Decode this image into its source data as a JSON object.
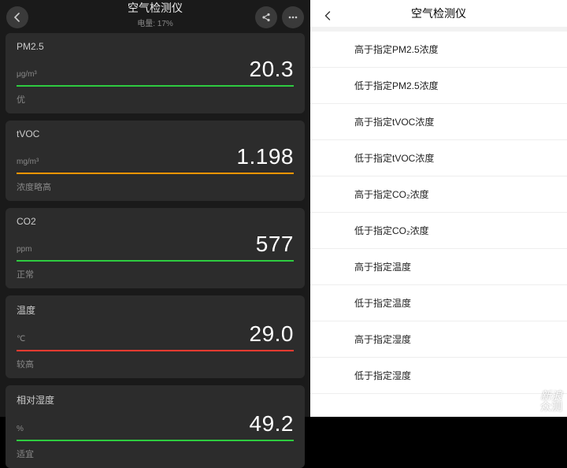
{
  "left": {
    "title": "空气检测仪",
    "subtitle": "电量: 17%",
    "cards": [
      {
        "name": "PM2.5",
        "unit": "μg/m³",
        "value": "20.3",
        "status": "优",
        "barColor": "green"
      },
      {
        "name": "tVOC",
        "unit": "mg/m³",
        "value": "1.198",
        "status": "浓度略高",
        "barColor": "orange"
      },
      {
        "name": "CO2",
        "unit": "ppm",
        "value": "577",
        "status": "正常",
        "barColor": "green"
      },
      {
        "name": "温度",
        "unit": "℃",
        "value": "29.0",
        "status": "较高",
        "barColor": "red"
      },
      {
        "name": "相对湿度",
        "unit": "%",
        "value": "49.2",
        "status": "适宜",
        "barColor": "green"
      }
    ]
  },
  "right": {
    "title": "空气检测仪",
    "items": [
      "高于指定PM2.5浓度",
      "低于指定PM2.5浓度",
      "高于指定tVOC浓度",
      "低于指定tVOC浓度",
      "高于指定CO₂浓度",
      "低于指定CO₂浓度",
      "高于指定温度",
      "低于指定温度",
      "高于指定湿度",
      "低于指定湿度"
    ]
  },
  "watermark": {
    "line1": "新浪",
    "line2": "众测"
  }
}
